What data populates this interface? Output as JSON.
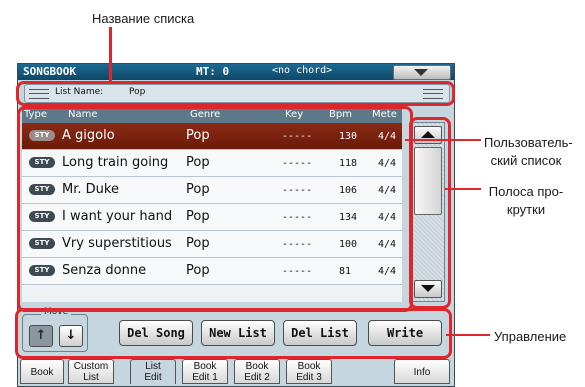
{
  "annotations": {
    "list_name": "Название списка",
    "user_list_l1": "Пользователь-",
    "user_list_l2": "ский список",
    "scrollbar_l1": "Полоса про-",
    "scrollbar_l2": "крутки",
    "controls": "Управление"
  },
  "titlebar": {
    "title": "SONGBOOK",
    "mt": "MT: 0",
    "chord": "<no chord>"
  },
  "list_name_bar": {
    "label": "List Name:",
    "value": "Pop"
  },
  "columns": {
    "type": "Type",
    "name": "Name",
    "genre": "Genre",
    "key": "Key",
    "bpm": "Bpm",
    "meter": "Mete"
  },
  "rows": [
    {
      "type": "STY",
      "name": "A gigolo",
      "genre": "Pop",
      "key": "-----",
      "bpm": "130",
      "meter": "4/4"
    },
    {
      "type": "STY",
      "name": "Long train going",
      "genre": "Pop",
      "key": "-----",
      "bpm": "118",
      "meter": "4/4"
    },
    {
      "type": "STY",
      "name": "Mr. Duke",
      "genre": "Pop",
      "key": "-----",
      "bpm": "106",
      "meter": "4/4"
    },
    {
      "type": "STY",
      "name": "I want your hand",
      "genre": "Pop",
      "key": "-----",
      "bpm": "134",
      "meter": "4/4"
    },
    {
      "type": "STY",
      "name": "Vry superstitious",
      "genre": "Pop",
      "key": "-----",
      "bpm": "100",
      "meter": "4/4"
    },
    {
      "type": "STY",
      "name": "Senza donne",
      "genre": "Pop",
      "key": "-----",
      "bpm": "81",
      "meter": "4/4"
    }
  ],
  "controls": {
    "move_label": "Move",
    "move_up": "↑",
    "move_down": "↓",
    "del_song": "Del Song",
    "new_list": "New List",
    "del_list": "Del List",
    "write": "Write"
  },
  "tabs": [
    {
      "l1": "Book",
      "l2": ""
    },
    {
      "l1": "Custom",
      "l2": "List"
    },
    {
      "l1": "List",
      "l2": "Edit"
    },
    {
      "l1": "Book",
      "l2": "Edit 1"
    },
    {
      "l1": "Book",
      "l2": "Edit 2"
    },
    {
      "l1": "Book",
      "l2": "Edit 3"
    },
    {
      "l1": "Info",
      "l2": ""
    }
  ],
  "icons": {
    "menu": "dropdown-triangle-icon",
    "grip": "grip-lines-icon",
    "scroll_up": "arrow-up-icon",
    "scroll_down": "arrow-down-icon"
  },
  "colors": {
    "accent_red": "#e0262d",
    "selected_row": "#7a2210",
    "titlebar": "#16597c"
  }
}
